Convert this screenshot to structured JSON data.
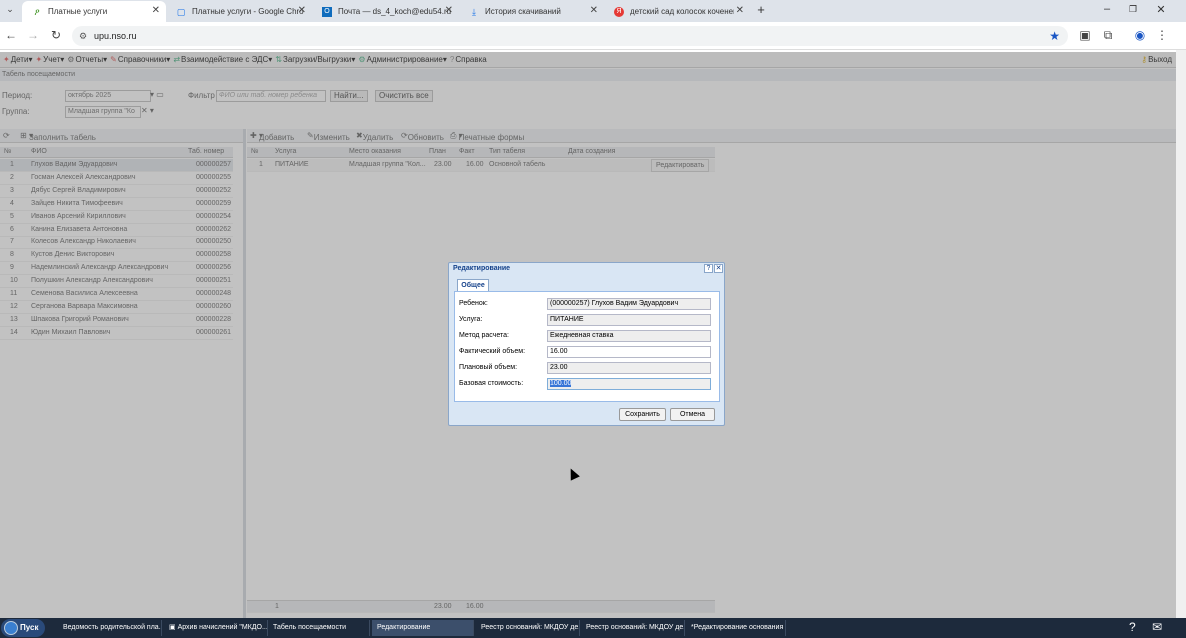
{
  "browser": {
    "tabs": [
      {
        "title": "Платные услуги",
        "icon": "leaf-icon"
      },
      {
        "title": "Платные услуги - Google Chro",
        "icon": "docs-icon"
      },
      {
        "title": "Почта — ds_4_koch@edu54.ru",
        "icon": "outlook-icon"
      },
      {
        "title": "История скачиваний",
        "icon": "download-icon"
      },
      {
        "title": "детский сад колосок коченев",
        "icon": "yandex-icon"
      }
    ],
    "url": "upu.nso.ru"
  },
  "app_menu": {
    "items": [
      "Дети",
      "Учет",
      "Отчеты",
      "Справочники",
      "Взаимодействие с ЭДС",
      "Загрузки/Выгрузки",
      "Администрирование",
      "Справка"
    ],
    "exit": "Выход"
  },
  "page": {
    "title": "Табель посещаемости",
    "period_label": "Период:",
    "period_value": "октябрь 2025",
    "group_label": "Группа:",
    "group_value": "Младшая группа \"Ко",
    "filter_label": "Фильтр",
    "filter_placeholder": "ФИО или таб. номер ребенка",
    "find_btn": "Найти...",
    "clear_btn": "Очистить все"
  },
  "left_grid": {
    "toolbar_btn": "Заполнить табель",
    "headers": [
      "№",
      "ФИО",
      "Таб. номер"
    ],
    "rows": [
      [
        "1",
        "Глухов Вадим Эдуардович",
        "000000257"
      ],
      [
        "2",
        "Госман Алексей Александрович",
        "000000255"
      ],
      [
        "3",
        "Дябус Сергей Владимирович",
        "000000252"
      ],
      [
        "4",
        "Зайцев Никита Тимофеевич",
        "000000259"
      ],
      [
        "5",
        "Иванов Арсений Кириллович",
        "000000254"
      ],
      [
        "6",
        "Канина Елизавета Антоновна",
        "000000262"
      ],
      [
        "7",
        "Колесов Александр Николаевич",
        "000000250"
      ],
      [
        "8",
        "Кустов Денис Викторович",
        "000000258"
      ],
      [
        "9",
        "Надемлинский Александр Александрович",
        "000000256"
      ],
      [
        "10",
        "Полушкин Александр Александрович",
        "000000251"
      ],
      [
        "11",
        "Семенова Василиса Алексеевна",
        "000000248"
      ],
      [
        "12",
        "Серганова Варвара Максимовна",
        "000000260"
      ],
      [
        "13",
        "Шпакова Григорий Романович",
        "000000228"
      ],
      [
        "14",
        "Юдин Михаил Павлович",
        "000000261"
      ]
    ]
  },
  "right_grid": {
    "toolbar": [
      "Добавить",
      "Изменить",
      "Удалить",
      "Обновить",
      "Печатные формы"
    ],
    "headers": [
      "№",
      "Услуга",
      "Место оказания",
      "План",
      "Факт",
      "Тип табеля",
      "Дата создания"
    ],
    "row": [
      "1",
      "ПИТАНИЕ",
      "Младшая группа \"Кол...",
      "23.00",
      "16.00",
      "Основной табель",
      ""
    ],
    "edit_btn": "Редактировать",
    "footer": [
      "1",
      "23.00",
      "16.00"
    ]
  },
  "dialog": {
    "title": "Редактирование",
    "tab": "Общее",
    "fields": [
      {
        "label": "Ребенок:",
        "value": "(000000257) Глухов Вадим Эдуардович"
      },
      {
        "label": "Услуга:",
        "value": "ПИТАНИЕ"
      },
      {
        "label": "Метод расчета:",
        "value": "Ежедневная ставка"
      },
      {
        "label": "Фактический объем:",
        "value": "16.00"
      },
      {
        "label": "Плановый объем:",
        "value": "23.00"
      },
      {
        "label": "Базовая стоимость:",
        "value": "100.00"
      }
    ],
    "save": "Сохранить",
    "cancel": "Отмена"
  },
  "taskbar": {
    "start": "Пуск",
    "items": [
      "Ведомость родительской пла...",
      "Архив начислений \"МКДО...",
      "Табель посещаемости",
      "Редактирование",
      "Реестр оснований: МКДОУ де...",
      "Реестр оснований: МКДОУ де...",
      "*Редактирование основания"
    ]
  }
}
